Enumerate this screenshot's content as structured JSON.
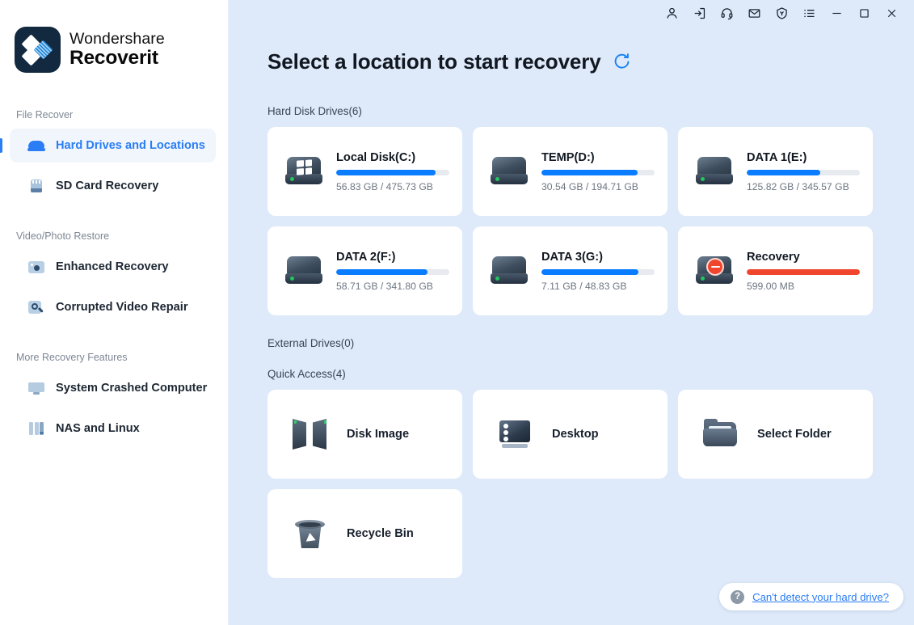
{
  "brand": {
    "line1": "Wondershare",
    "line2": "Recoverit"
  },
  "titlebar": {
    "buttons": [
      {
        "name": "account-icon",
        "label": "Account"
      },
      {
        "name": "sign-in-icon",
        "label": "Sign In"
      },
      {
        "name": "headset-support-icon",
        "label": "Support"
      },
      {
        "name": "mail-icon",
        "label": "Feedback"
      },
      {
        "name": "shield-badge-icon",
        "label": "Security"
      },
      {
        "name": "menu-list-icon",
        "label": "Menu"
      },
      {
        "name": "minimize-icon",
        "label": "Minimize"
      },
      {
        "name": "maximize-icon",
        "label": "Maximize"
      },
      {
        "name": "close-icon",
        "label": "Close"
      }
    ]
  },
  "sidebar": {
    "groups": [
      {
        "title": "File Recover",
        "items": [
          {
            "label": "Hard Drives and Locations",
            "icon": "hard-drive-icon",
            "active": true
          },
          {
            "label": "SD Card Recovery",
            "icon": "sd-card-icon",
            "active": false
          }
        ]
      },
      {
        "title": "Video/Photo Restore",
        "items": [
          {
            "label": "Enhanced Recovery",
            "icon": "camera-icon",
            "active": false
          },
          {
            "label": "Corrupted Video Repair",
            "icon": "video-repair-icon",
            "active": false
          }
        ]
      },
      {
        "title": "More Recovery Features",
        "items": [
          {
            "label": "System Crashed Computer",
            "icon": "monitor-icon",
            "active": false
          },
          {
            "label": "NAS and Linux",
            "icon": "nas-server-icon",
            "active": false
          }
        ]
      }
    ]
  },
  "main": {
    "page_title": "Select a location to start recovery",
    "refresh_icon": "refresh-icon",
    "sections": {
      "hard_disk_drives": "Hard Disk Drives(6)",
      "external_drives": "External Drives(0)",
      "quick_access": "Quick Access(4)"
    },
    "drives": [
      {
        "name": "Local Disk(C:)",
        "size": "56.83 GB / 475.73 GB",
        "fill_percent": 88,
        "bar_color": "#0a7cff",
        "icon": "windows-drive-icon"
      },
      {
        "name": "TEMP(D:)",
        "size": "30.54 GB / 194.71 GB",
        "fill_percent": 85,
        "bar_color": "#0a7cff",
        "icon": "hard-drive-icon"
      },
      {
        "name": "DATA 1(E:)",
        "size": "125.82 GB / 345.57 GB",
        "fill_percent": 65,
        "bar_color": "#0a7cff",
        "icon": "hard-drive-icon"
      },
      {
        "name": "DATA 2(F:)",
        "size": "58.71 GB / 341.80 GB",
        "fill_percent": 81,
        "bar_color": "#0a7cff",
        "icon": "hard-drive-icon"
      },
      {
        "name": "DATA 3(G:)",
        "size": "7.11 GB / 48.83 GB",
        "fill_percent": 86,
        "bar_color": "#0a7cff",
        "icon": "hard-drive-icon"
      },
      {
        "name": "Recovery",
        "size": "599.00 MB",
        "fill_percent": 100,
        "bar_color": "#f0462d",
        "icon": "locked-drive-icon"
      }
    ],
    "quick_access": [
      {
        "label": "Disk Image",
        "icon": "disk-image-icon"
      },
      {
        "label": "Desktop",
        "icon": "desktop-icon"
      },
      {
        "label": "Select Folder",
        "icon": "folder-icon"
      },
      {
        "label": "Recycle Bin",
        "icon": "recycle-bin-icon"
      }
    ],
    "help": {
      "icon": "question-mark-icon",
      "text": "Can't detect your hard drive?"
    }
  },
  "colors": {
    "accent": "#2a7df4",
    "bar_blue": "#0a7cff",
    "bar_red": "#f0462d",
    "main_bg": "#deeafa",
    "card_bg": "#ffffff"
  }
}
